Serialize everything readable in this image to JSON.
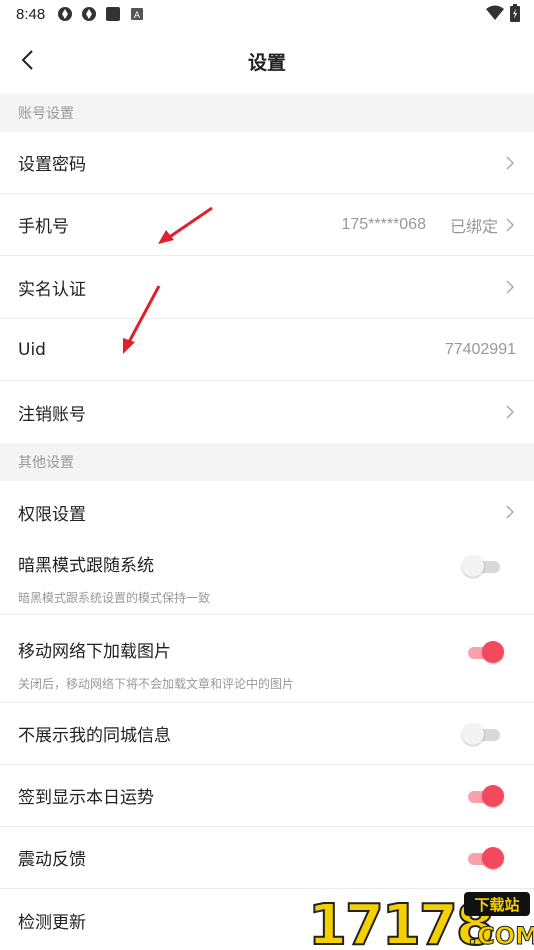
{
  "status_bar": {
    "time": "8:48"
  },
  "header": {
    "title": "设置"
  },
  "account_section": {
    "title": "账号设置",
    "set_password": "设置密码",
    "phone_label": "手机号",
    "phone_value": "175*****068",
    "phone_status": "已绑定",
    "realname": "实名认证",
    "uid_label": "Uid",
    "uid_value": "77402991",
    "cancel_account": "注销账号"
  },
  "other_section": {
    "title": "其他设置",
    "permissions": "权限设置",
    "dark_mode": {
      "label": "暗黑模式跟随系统",
      "desc": "暗黑模式跟系统设置的模式保持一致",
      "enabled": false
    },
    "mobile_images": {
      "label": "移动网络下加载图片",
      "desc": "关闭后，移动网络下将不会加载文章和评论中的图片",
      "enabled": true
    },
    "hide_local": {
      "label": "不展示我的同城信息",
      "enabled": false
    },
    "checkin_fortune": {
      "label": "签到显示本日运势",
      "enabled": true
    },
    "vibration": {
      "label": "震动反馈",
      "enabled": true
    },
    "check_update": "检测更新"
  },
  "watermark": {
    "number": "17178",
    "badge": "下载站",
    "suffix": ".COM"
  },
  "colors": {
    "accent": "#f24a5c",
    "accent_track": "#f7a3ac",
    "arrow": "#e0202a",
    "watermark_yellow": "#f5d000"
  }
}
